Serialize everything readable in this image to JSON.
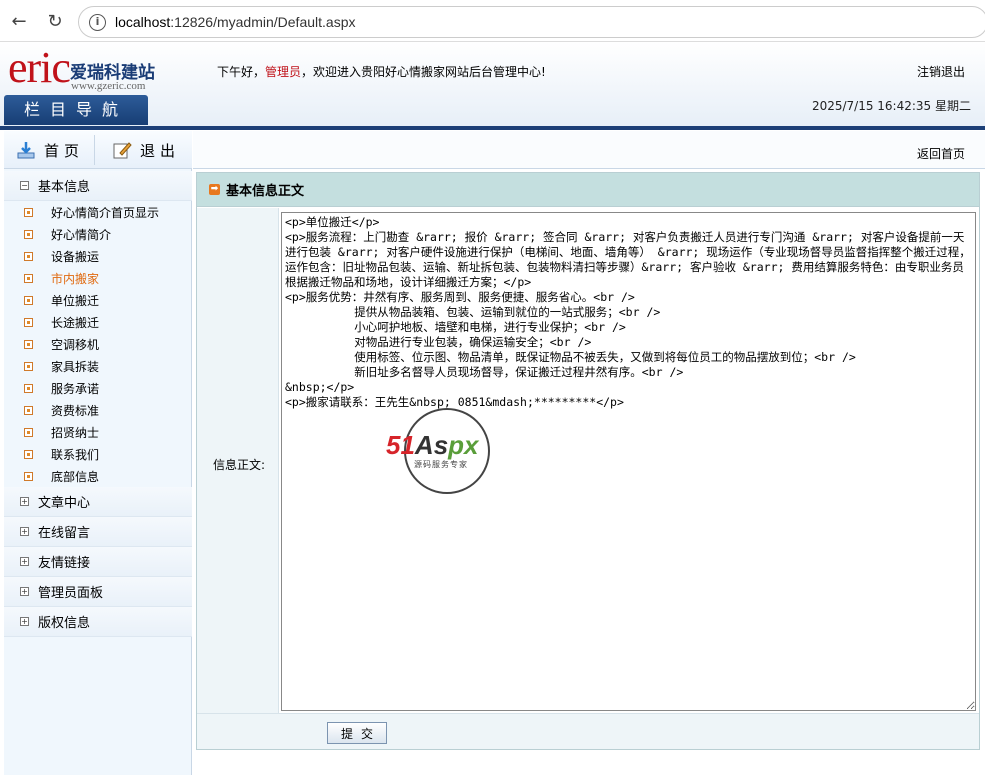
{
  "browser": {
    "url_host": "localhost",
    "url_rest": ":12826/myadmin/Default.aspx"
  },
  "header": {
    "logo_text": "eric",
    "logo_cn": "爱瑞科建站",
    "logo_url": "www.gzeric.com",
    "greeting_prefix": "下午好，",
    "admin_name": "管理员",
    "greeting_suffix": "，欢迎进入贵阳好心情搬家网站后台管理中心!",
    "logout": "注销退出",
    "nav_title": "栏目导航",
    "datetime": "2025/7/15 16:42:35 星期二"
  },
  "sidebar": {
    "home_label": "首页",
    "exit_label": "退出",
    "groups": [
      {
        "label": "基本信息",
        "expanded": true,
        "items": [
          "好心情简介首页显示",
          "好心情简介",
          "设备搬运",
          "市内搬家",
          "单位搬迁",
          "长途搬迁",
          "空调移机",
          "家具拆装",
          "服务承诺",
          "资费标准",
          "招贤纳士",
          "联系我们",
          "底部信息"
        ],
        "active": "市内搬家"
      },
      {
        "label": "文章中心",
        "expanded": false
      },
      {
        "label": "在线留言",
        "expanded": false
      },
      {
        "label": "友情链接",
        "expanded": false
      },
      {
        "label": "管理员面板",
        "expanded": false
      },
      {
        "label": "版权信息",
        "expanded": false
      }
    ]
  },
  "main": {
    "back_home": "返回首页",
    "panel_title": "基本信息正文",
    "field_label": "信息正文:",
    "content": "<p>单位搬迁</p>\n<p>服务流程：上门勘查 &rarr; 报价 &rarr; 签合同 &rarr; 对客户负责搬迁人员进行专门沟通 &rarr; 对客户设备提前一天进行包装 &rarr; 对客户硬件设施进行保护（电梯间、地面、墙角等） &rarr; 现场运作（专业现场督导员监督指挥整个搬迁过程，运作包含：旧址物品包装、运输、新址拆包装、包装物料清扫等步骤）&rarr; 客户验收 &rarr; 费用结算服务特色：由专职业务员根据搬迁物品和场地，设计详细搬迁方案；</p>\n<p>服务优势：井然有序、服务周到、服务便捷、服务省心。<br />\n          提供从物品装箱、包装、运输到就位的一站式服务；<br />\n          小心呵护地板、墙壁和电梯，进行专业保护；<br />\n          对物品进行专业包装，确保运输安全；<br />\n          使用标签、位示图、物品清单，既保证物品不被丢失，又做到将每位员工的物品摆放到位；<br />\n          新旧址多名督导人员现场督导，保证搬迁过程井然有序。<br />\n&nbsp;</p>\n<p>搬家请联系：王先生&nbsp; 0851&mdash;*********</p>",
    "submit": "提交"
  },
  "watermark": {
    "part1": "51",
    "part2": "As",
    "part3": "px",
    "sub": "源码服务专家"
  },
  "colors": {
    "brand_red": "#c0121a",
    "nav_blue": "#1c3f77",
    "panel_head": "#c4dfdf",
    "active_orange": "#e06a10"
  }
}
